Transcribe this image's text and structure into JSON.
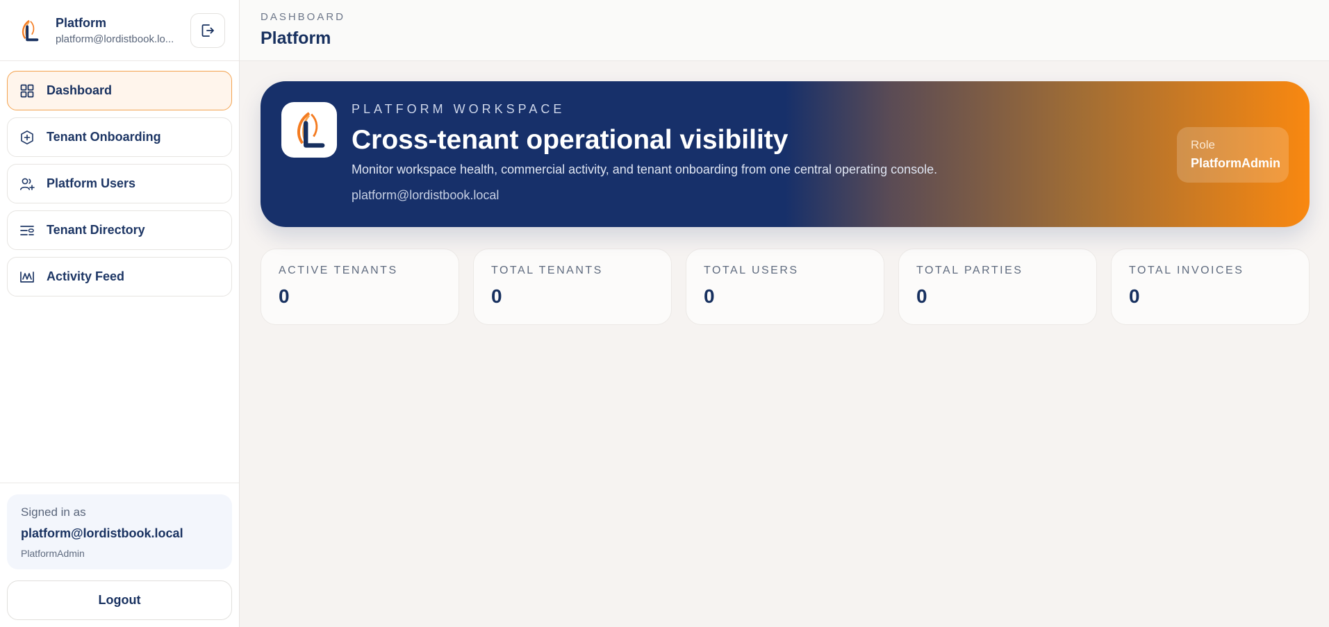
{
  "colors": {
    "navy": "#17305f",
    "accent": "#f98810",
    "active_border": "#f3a24e",
    "active_bg": "#fff5ec"
  },
  "sidebar": {
    "brand_name": "Platform",
    "brand_email": "platform@lordistbook.lo...",
    "signout_icon": "sign-out-icon",
    "items": [
      {
        "label": "Dashboard",
        "icon": "grid-icon",
        "active": true
      },
      {
        "label": "Tenant Onboarding",
        "icon": "cube-plus-icon",
        "active": false
      },
      {
        "label": "Platform Users",
        "icon": "user-plus-icon",
        "active": false
      },
      {
        "label": "Tenant Directory",
        "icon": "list-filter-icon",
        "active": false
      },
      {
        "label": "Activity Feed",
        "icon": "activity-icon",
        "active": false
      }
    ],
    "footer": {
      "signed_in_label": "Signed in as",
      "email": "platform@lordistbook.local",
      "role": "PlatformAdmin",
      "logout_label": "Logout"
    }
  },
  "topbar": {
    "eyebrow": "DASHBOARD",
    "title": "Platform"
  },
  "hero": {
    "eyebrow": "PLATFORM WORKSPACE",
    "title": "Cross-tenant operational visibility",
    "description": "Monitor workspace health, commercial activity, and tenant onboarding from one central operating console.",
    "email": "platform@lordistbook.local",
    "role_label": "Role",
    "role_value": "PlatformAdmin"
  },
  "stats": [
    {
      "label": "ACTIVE TENANTS",
      "value": "0"
    },
    {
      "label": "TOTAL TENANTS",
      "value": "0"
    },
    {
      "label": "TOTAL USERS",
      "value": "0"
    },
    {
      "label": "TOTAL PARTIES",
      "value": "0"
    },
    {
      "label": "TOTAL INVOICES",
      "value": "0"
    }
  ]
}
